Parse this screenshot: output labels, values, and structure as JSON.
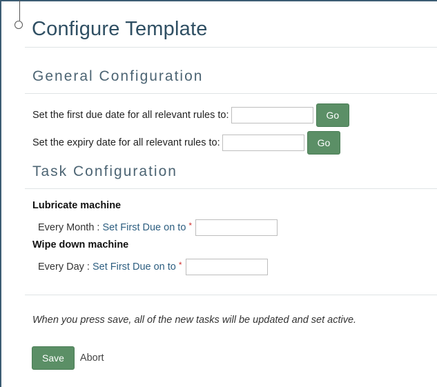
{
  "page": {
    "title": "Configure Template"
  },
  "general": {
    "heading": "General Configuration",
    "first_due_label": "Set the first due date for all relevant rules to:",
    "first_due_value": "",
    "first_due_button": "Go",
    "expiry_label": "Set the expiry date for all relevant rules to:",
    "expiry_value": "",
    "expiry_button": "Go"
  },
  "task_config": {
    "heading": "Task Configuration",
    "tasks": [
      {
        "name": "Lubricate machine",
        "frequency": "Every Month",
        "separator": " : ",
        "field_label": "Set First Due on to",
        "required_mark": "*",
        "value": ""
      },
      {
        "name": "Wipe down machine",
        "frequency": "Every Day",
        "separator": " : ",
        "field_label": "Set First Due on to",
        "required_mark": "*",
        "value": ""
      }
    ]
  },
  "note": "When you press save, all of the new tasks will be updated and set active.",
  "actions": {
    "save_label": "Save",
    "abort_label": "Abort"
  },
  "colors": {
    "button": "#5b8f66",
    "title": "#2f4f63",
    "link": "#2d5e80",
    "required": "#d0302e"
  }
}
